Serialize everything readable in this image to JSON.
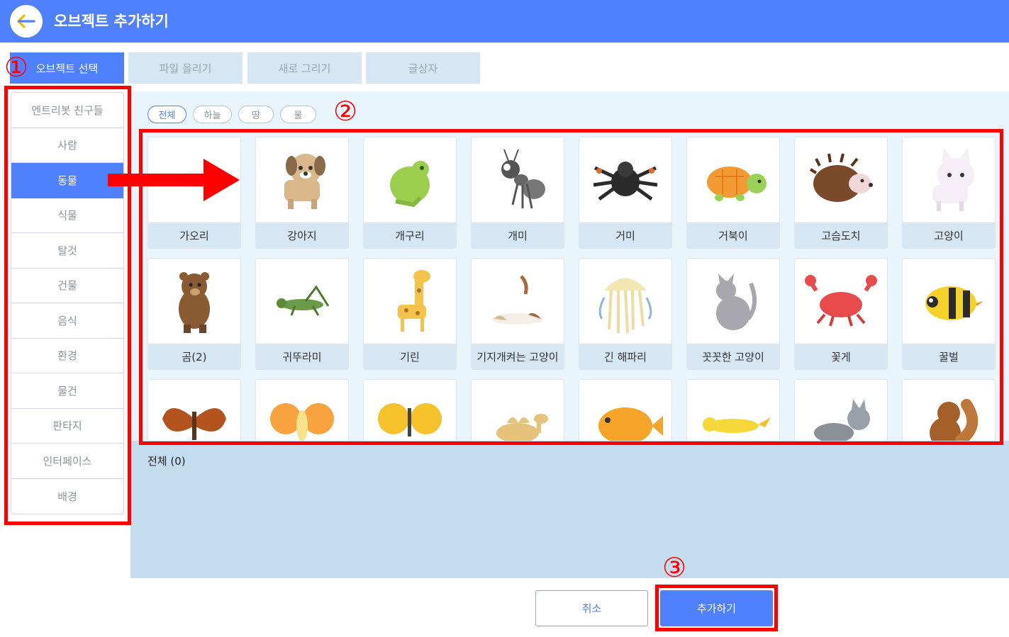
{
  "header": {
    "title": "오브젝트 추가하기",
    "back_icon": "arrow-left-icon"
  },
  "tabs": [
    {
      "label": "오브젝트 선택",
      "active": true
    },
    {
      "label": "파일 올리기"
    },
    {
      "label": "새로 그리기"
    },
    {
      "label": "글상자"
    }
  ],
  "sidebar": {
    "items": [
      {
        "label": "엔트리봇 친구들"
      },
      {
        "label": "사람"
      },
      {
        "label": "동물",
        "active": true
      },
      {
        "label": "식물"
      },
      {
        "label": "탈것"
      },
      {
        "label": "건물"
      },
      {
        "label": "음식"
      },
      {
        "label": "환경"
      },
      {
        "label": "물건"
      },
      {
        "label": "판타지"
      },
      {
        "label": "인터페이스"
      },
      {
        "label": "배경"
      }
    ]
  },
  "filters": [
    {
      "label": "전체",
      "active": true
    },
    {
      "label": "하늘"
    },
    {
      "label": "땅"
    },
    {
      "label": "물"
    }
  ],
  "objects": [
    {
      "label": "가오리",
      "icon": "stingray"
    },
    {
      "label": "강아지",
      "icon": "dog"
    },
    {
      "label": "개구리",
      "icon": "frog"
    },
    {
      "label": "개미",
      "icon": "ant"
    },
    {
      "label": "거미",
      "icon": "spider"
    },
    {
      "label": "거북이",
      "icon": "turtle"
    },
    {
      "label": "고슴도치",
      "icon": "hedgehog"
    },
    {
      "label": "고양이",
      "icon": "cat"
    },
    {
      "label": "곰(2)",
      "icon": "bear"
    },
    {
      "label": "귀뚜라미",
      "icon": "cricket"
    },
    {
      "label": "기린",
      "icon": "giraffe"
    },
    {
      "label": "기지개켜는 고양이",
      "icon": "stretching-cat"
    },
    {
      "label": "긴 해파리",
      "icon": "jellyfish"
    },
    {
      "label": "꼿꼿한 고양이",
      "icon": "sitting-cat"
    },
    {
      "label": "꽃게",
      "icon": "crab"
    },
    {
      "label": "꿀벌",
      "icon": "bee"
    },
    {
      "label": "",
      "icon": "moth"
    },
    {
      "label": "",
      "icon": "butterfly-orange"
    },
    {
      "label": "",
      "icon": "butterfly-yellow"
    },
    {
      "label": "",
      "icon": "camel"
    },
    {
      "label": "",
      "icon": "pufferfish"
    },
    {
      "label": "",
      "icon": "canary"
    },
    {
      "label": "",
      "icon": "wolf"
    },
    {
      "label": "",
      "icon": "squirrel"
    }
  ],
  "selected_panel": {
    "title": "전체 (0)"
  },
  "buttons": {
    "cancel": "취소",
    "add": "추가하기"
  },
  "annotations": {
    "one": "①",
    "two": "②",
    "three": "③",
    "color": "#ff0000"
  },
  "colors": {
    "accent": "#4f80ff",
    "tab_inactive": "#d6e6f3",
    "panel": "#e9f5fc",
    "selected_panel": "#c3dcee"
  }
}
